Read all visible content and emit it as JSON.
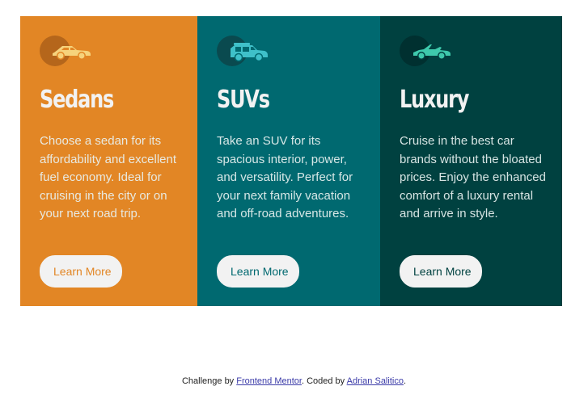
{
  "colors": {
    "sedans_bg": "#e28625",
    "suvs_bg": "#006970",
    "luxury_bg": "#004140",
    "button_bg": "#f2f2f2",
    "icon_color_sedans": "#f6d37c",
    "icon_color_suvs": "#3fc0c9",
    "icon_color_luxury": "#3ec9ac"
  },
  "cards": [
    {
      "icon": "sedan-car-icon",
      "title": "Sedans",
      "description": "Choose a sedan for its affordability and excellent fuel economy. Ideal for cruising in the city or on your next road trip.",
      "button_label": "Learn More"
    },
    {
      "icon": "suv-car-icon",
      "title": "SUVs",
      "description": "Take an SUV for its spacious interior, power, and versatility. Perfect for your next family vacation and off-road adventures.",
      "button_label": "Learn More"
    },
    {
      "icon": "luxury-car-icon",
      "title": "Luxury",
      "description": "Cruise in the best car brands without the bloated prices. Enjoy the enhanced comfort of a luxury rental and arrive in style.",
      "button_label": "Learn More"
    }
  ],
  "footer": {
    "prefix": "Challenge by ",
    "challenge_link": "Frontend Mentor",
    "middle": ". Coded by ",
    "author_link": "Adrian Salitico",
    "suffix": "."
  }
}
